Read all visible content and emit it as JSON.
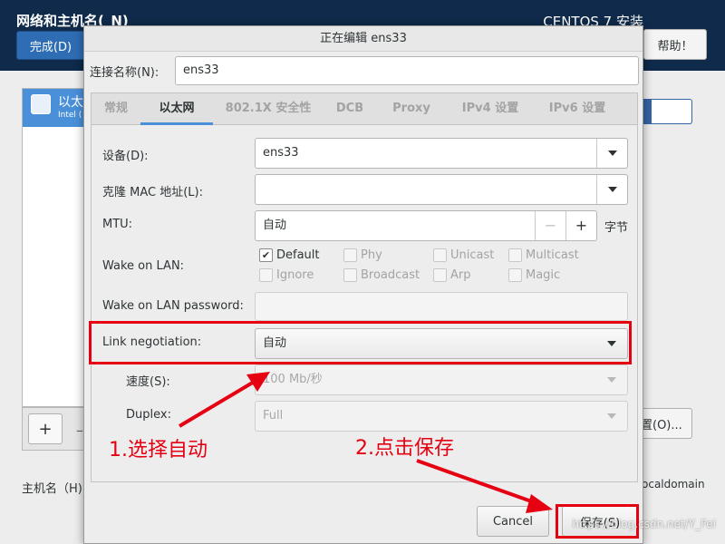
{
  "background": {
    "title": "网络和主机名(_N)",
    "product": "CENTOS 7 安装",
    "done_button": "完成(D)",
    "help_button": "帮助！",
    "device_name": "以太",
    "device_sub": "Intel (",
    "add_button": "+",
    "remove_button": "–",
    "configure_button": "置(O)...",
    "hostname_label": "主机名（H)",
    "domain_text": "ocaldomain"
  },
  "dialog": {
    "title": "正在编辑 ens33",
    "connection_name_label": "连接名称(N):",
    "connection_name_value": "ens33",
    "tabs": [
      {
        "label": "常规",
        "active": false
      },
      {
        "label": "以太网",
        "active": true
      },
      {
        "label": "802.1X 安全性",
        "active": false
      },
      {
        "label": "DCB",
        "active": false
      },
      {
        "label": "Proxy",
        "active": false
      },
      {
        "label": "IPv4 设置",
        "active": false
      },
      {
        "label": "IPv6 设置",
        "active": false
      }
    ],
    "ethernet": {
      "device_label": "设备(D):",
      "device_value": "ens33",
      "clone_mac_label": "克隆 MAC 地址(L):",
      "clone_mac_value": "",
      "mtu_label": "MTU:",
      "mtu_value": "自动",
      "mtu_unit": "字节",
      "mtu_dec": "−",
      "mtu_inc": "+",
      "wol_label": "Wake on LAN:",
      "wol_options": [
        {
          "label": "Default",
          "checked": true,
          "enabled": true
        },
        {
          "label": "Phy",
          "checked": false,
          "enabled": false
        },
        {
          "label": "Unicast",
          "checked": false,
          "enabled": false
        },
        {
          "label": "Multicast",
          "checked": false,
          "enabled": false
        },
        {
          "label": "Ignore",
          "checked": false,
          "enabled": false
        },
        {
          "label": "Broadcast",
          "checked": false,
          "enabled": false
        },
        {
          "label": "Arp",
          "checked": false,
          "enabled": false
        },
        {
          "label": "Magic",
          "checked": false,
          "enabled": false
        }
      ],
      "wol_password_label": "Wake on LAN password:",
      "wol_password_value": "",
      "link_negotiation_label": "Link negotiation:",
      "link_negotiation_value": "自动",
      "speed_label": "速度(S):",
      "speed_value": "100 Mb/秒",
      "duplex_label": "Duplex:",
      "duplex_value": "Full"
    },
    "cancel_button": "Cancel",
    "save_button": "保存(S)"
  },
  "annotations": {
    "step1": "1.选择自动",
    "step2": "2.点击保存",
    "watermark": "https://blog.csdn.net/Y_Fei",
    "color": "#e50012"
  }
}
